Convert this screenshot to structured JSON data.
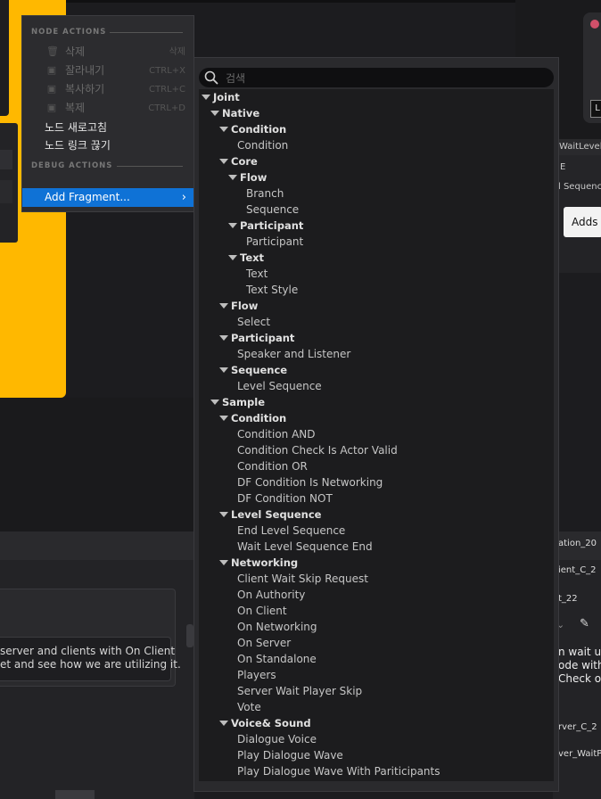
{
  "context_menu": {
    "node_actions_header": "NODE ACTIONS",
    "debug_actions_header": "DEBUG ACTIONS",
    "items": [
      {
        "label": "삭제",
        "shortcut": "삭제",
        "icon": "trash-icon"
      },
      {
        "label": "잘라내기",
        "shortcut": "CTRL+X",
        "icon": "cut-icon"
      },
      {
        "label": "복사하기",
        "shortcut": "CTRL+C",
        "icon": "copy-icon"
      },
      {
        "label": "복제",
        "shortcut": "CTRL+D",
        "icon": "duplicate-icon"
      }
    ],
    "refresh_nodes": "노드 새로고침",
    "break_links": "노드 링크 끊기",
    "add_fragment": "Add Fragment..."
  },
  "picker": {
    "search_placeholder": "검색",
    "tree": [
      {
        "label": "Joint",
        "cat": true
      },
      {
        "label": "Native",
        "cat": true
      },
      {
        "label": "Condition",
        "cat": true
      },
      {
        "label": "Condition",
        "cat": false
      },
      {
        "label": "Core",
        "cat": true
      },
      {
        "label": "Flow",
        "cat": true
      },
      {
        "label": "Branch",
        "cat": false
      },
      {
        "label": "Sequence",
        "cat": false
      },
      {
        "label": "Participant",
        "cat": true
      },
      {
        "label": "Participant",
        "cat": false
      },
      {
        "label": "Text",
        "cat": true
      },
      {
        "label": "Text",
        "cat": false
      },
      {
        "label": "Text Style",
        "cat": false
      },
      {
        "label": "Flow",
        "cat": true
      },
      {
        "label": "Select",
        "cat": false
      },
      {
        "label": "Participant",
        "cat": true
      },
      {
        "label": "Speaker and Listener",
        "cat": false
      },
      {
        "label": "Sequence",
        "cat": true
      },
      {
        "label": "Level Sequence",
        "cat": false
      },
      {
        "label": "Sample",
        "cat": true
      },
      {
        "label": "Condition",
        "cat": true
      },
      {
        "label": "Condition AND",
        "cat": false
      },
      {
        "label": "Condition Check Is Actor Valid",
        "cat": false
      },
      {
        "label": "Condition OR",
        "cat": false
      },
      {
        "label": "DF Condition Is Networking",
        "cat": false
      },
      {
        "label": "DF Condition NOT",
        "cat": false
      },
      {
        "label": "Level Sequence",
        "cat": true
      },
      {
        "label": "End Level Sequence",
        "cat": false
      },
      {
        "label": "Wait Level Sequence End",
        "cat": false
      },
      {
        "label": "Networking",
        "cat": true
      },
      {
        "label": "Client Wait Skip Request",
        "cat": false
      },
      {
        "label": "On Authority",
        "cat": false
      },
      {
        "label": "On Client",
        "cat": false
      },
      {
        "label": "On Networking",
        "cat": false
      },
      {
        "label": "On Server",
        "cat": false
      },
      {
        "label": "On Standalone",
        "cat": false
      },
      {
        "label": "Players",
        "cat": false
      },
      {
        "label": "Server Wait Player Skip",
        "cat": false
      },
      {
        "label": "Vote",
        "cat": false
      },
      {
        "label": "Voice& Sound",
        "cat": true
      },
      {
        "label": "Dialogue Voice",
        "cat": false
      },
      {
        "label": "Play Dialogue Wave",
        "cat": false
      },
      {
        "label": "Play Dialogue Wave With Pariticipants",
        "cat": false
      }
    ]
  },
  "background": {
    "comment_line1": "server and clients with On Client",
    "comment_line2": "et and see how we are utilizing it.",
    "right_header": "WaitLevelSe",
    "right_sub": "E",
    "right_sequence": "l Sequence I",
    "right_tooltip": "Adds",
    "right_node_btn": "L",
    "right_label1": "ation_20",
    "right_label2": "ient_C_2",
    "right_label3": "t_22",
    "right_body1": "n wait ur",
    "right_body2": "ode with S",
    "right_body3": "Check out",
    "right_label4": "rver_C_2",
    "right_label5": "ver_WaitPla"
  }
}
